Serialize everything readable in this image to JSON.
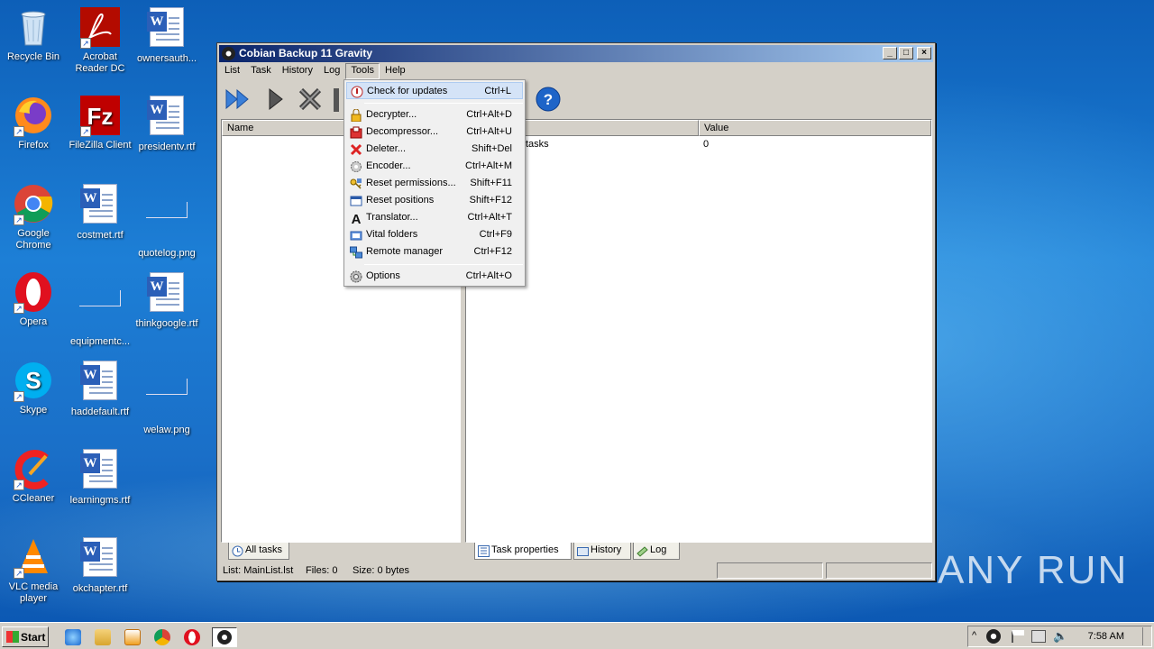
{
  "desktop": {
    "icons": [
      {
        "label": "Recycle Bin"
      },
      {
        "label": "Acrobat Reader DC"
      },
      {
        "label": "ownersauth..."
      },
      {
        "label": "Firefox"
      },
      {
        "label": "FileZilla Client"
      },
      {
        "label": "presidentv.rtf"
      },
      {
        "label": "Google Chrome"
      },
      {
        "label": "costmet.rtf"
      },
      {
        "label": "quotelog.png"
      },
      {
        "label": "Opera"
      },
      {
        "label": "equipmentc..."
      },
      {
        "label": "thinkgoogle.rtf"
      },
      {
        "label": "Skype"
      },
      {
        "label": "haddefault.rtf"
      },
      {
        "label": "welaw.png"
      },
      {
        "label": "CCleaner"
      },
      {
        "label": "learningms.rtf"
      },
      {
        "label": "VLC media player"
      },
      {
        "label": "okchapter.rtf"
      }
    ]
  },
  "window": {
    "title": "Cobian Backup 11 Gravity",
    "controls": {
      "minimize": "_",
      "maximize": "□",
      "close": "×"
    },
    "menu": [
      "List",
      "Task",
      "History",
      "Log",
      "Tools",
      "Help"
    ],
    "left_pane": {
      "column": "Name",
      "tab": "All tasks"
    },
    "right_pane": {
      "columns": [
        "",
        "Value"
      ],
      "row": {
        "name": "tasks",
        "value": "0"
      },
      "tabs": [
        "Task properties",
        "History",
        "Log"
      ]
    },
    "status": {
      "list": "List: MainList.lst",
      "files": "Files: 0",
      "size": "Size: 0 bytes"
    }
  },
  "tools_menu": [
    {
      "label": "Check for updates",
      "shortcut": "Ctrl+L",
      "icon": "update-icon"
    },
    {
      "label": "Decrypter...",
      "shortcut": "Ctrl+Alt+D",
      "icon": "lock-icon"
    },
    {
      "label": "Decompressor...",
      "shortcut": "Ctrl+Alt+U",
      "icon": "archive-icon"
    },
    {
      "label": "Deleter...",
      "shortcut": "Shift+Del",
      "icon": "delete-icon"
    },
    {
      "label": "Encoder...",
      "shortcut": "Ctrl+Alt+M",
      "icon": "gear-icon"
    },
    {
      "label": "Reset permissions...",
      "shortcut": "Shift+F11",
      "icon": "key-icon"
    },
    {
      "label": "Reset positions",
      "shortcut": "Shift+F12",
      "icon": "window-icon"
    },
    {
      "label": "Translator...",
      "shortcut": "Ctrl+Alt+T",
      "icon": "letter-a-icon"
    },
    {
      "label": "Vital folders",
      "shortcut": "Ctrl+F9",
      "icon": "folder-icon"
    },
    {
      "label": "Remote manager",
      "shortcut": "Ctrl+F12",
      "icon": "network-icon"
    },
    {
      "label": "Options",
      "shortcut": "Ctrl+Alt+O",
      "icon": "options-icon"
    }
  ],
  "taskbar": {
    "start": "Start",
    "clock": "7:58 AM"
  },
  "watermark": "ANY RUN",
  "colors": {
    "titlebar_start": "#0a246a",
    "titlebar_end": "#a6caf0",
    "menu_highlight": "#d4e3f7"
  }
}
